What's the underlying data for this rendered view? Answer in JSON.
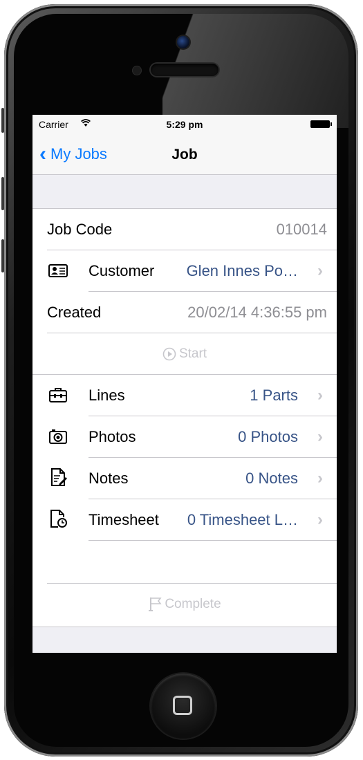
{
  "status": {
    "carrier": "Carrier",
    "time": "5:29 pm"
  },
  "nav": {
    "back_label": "My Jobs",
    "title": "Job"
  },
  "fields": {
    "job_code": {
      "label": "Job Code",
      "value": "010014"
    },
    "customer": {
      "label": "Customer",
      "value": "Glen Innes Po…",
      "icon": "customer-card-icon"
    },
    "created": {
      "label": "Created",
      "value": "20/02/14 4:36:55 pm"
    }
  },
  "start_label": "Start",
  "items": [
    {
      "label": "Lines",
      "value": "1 Parts",
      "icon": "toolbox-icon"
    },
    {
      "label": "Photos",
      "value": "0 Photos",
      "icon": "camera-icon"
    },
    {
      "label": "Notes",
      "value": "0 Notes",
      "icon": "notes-icon"
    },
    {
      "label": "Timesheet",
      "value": "0 Timesheet L…",
      "icon": "timesheet-icon"
    }
  ],
  "complete_label": "Complete",
  "colors": {
    "tint": "#0a7aff",
    "value_blue": "#385487",
    "disabled": "#c7c7cc",
    "separator": "#c8c7cc",
    "group_bg": "#efeff4"
  }
}
